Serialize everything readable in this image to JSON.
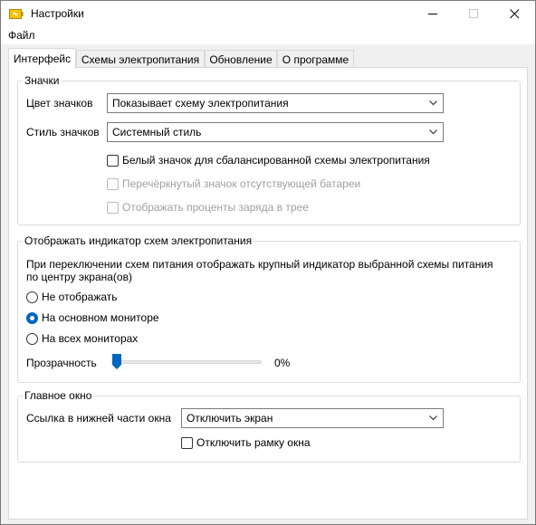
{
  "window": {
    "title": "Настройки",
    "accent_color": "#0067c0"
  },
  "menu": {
    "file": "Файл"
  },
  "tabs": [
    {
      "label": "Интерфейс",
      "active": true
    },
    {
      "label": "Схемы электропитания",
      "active": false
    },
    {
      "label": "Обновление",
      "active": false
    },
    {
      "label": "О программе",
      "active": false
    }
  ],
  "icons_group": {
    "legend": "Значки",
    "icon_color_label": "Цвет значков",
    "icon_color_value": "Показывает схему электропитания",
    "icon_style_label": "Стиль значков",
    "icon_style_value": "Системный стиль",
    "white_icon_checkbox": "Белый значок для сбалансированной схемы электропитания",
    "crossed_icon_checkbox": "Перечёркнутый значок отсутствующей батареи",
    "show_percent_checkbox": "Отображать проценты заряда в трее"
  },
  "indicator_group": {
    "legend": "Отображать индикатор схем электропитания",
    "description": "При переключении схем питания отображать крупный индикатор выбранной схемы питания по центру экрана(ов)",
    "radio_none": "Не отображать",
    "radio_main": "На основном мониторе",
    "radio_all": "На всех мониторах",
    "selected": "На основном мониторе",
    "transparency_label": "Прозрачность",
    "transparency_value": "0%",
    "transparency_level": 0
  },
  "main_window_group": {
    "legend": "Главное окно",
    "link_label": "Ссылка в нижней части окна",
    "link_value": "Отключить экран",
    "disable_frame_checkbox": "Отключить рамку окна"
  }
}
